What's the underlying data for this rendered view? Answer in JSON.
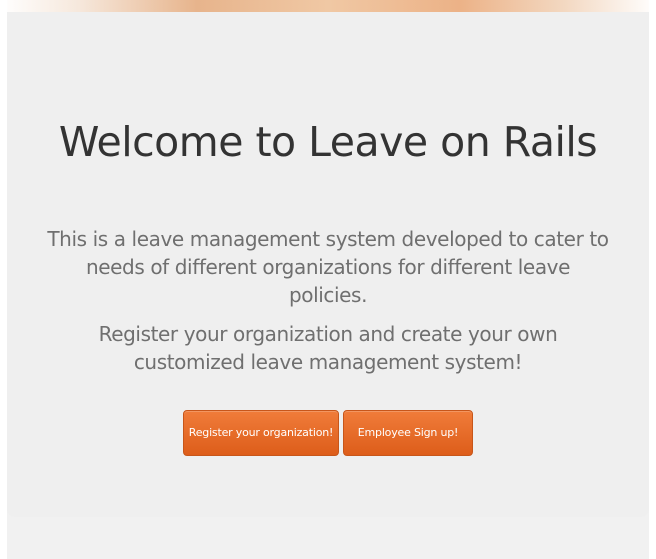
{
  "hero": {
    "title": "Welcome to Leave on Rails",
    "description": "This is a leave management system developed to cater to needs of different organizations for different leave policies.",
    "cta_text": "Register your organization and create your own customized leave management system!"
  },
  "actions": {
    "register_label": "Register your organization!",
    "signup_label": "Employee Sign up!"
  },
  "colors": {
    "button_orange": "#e4682a",
    "hero_background": "#efefef",
    "title_text": "#333333",
    "body_text": "#6f6f6f"
  }
}
